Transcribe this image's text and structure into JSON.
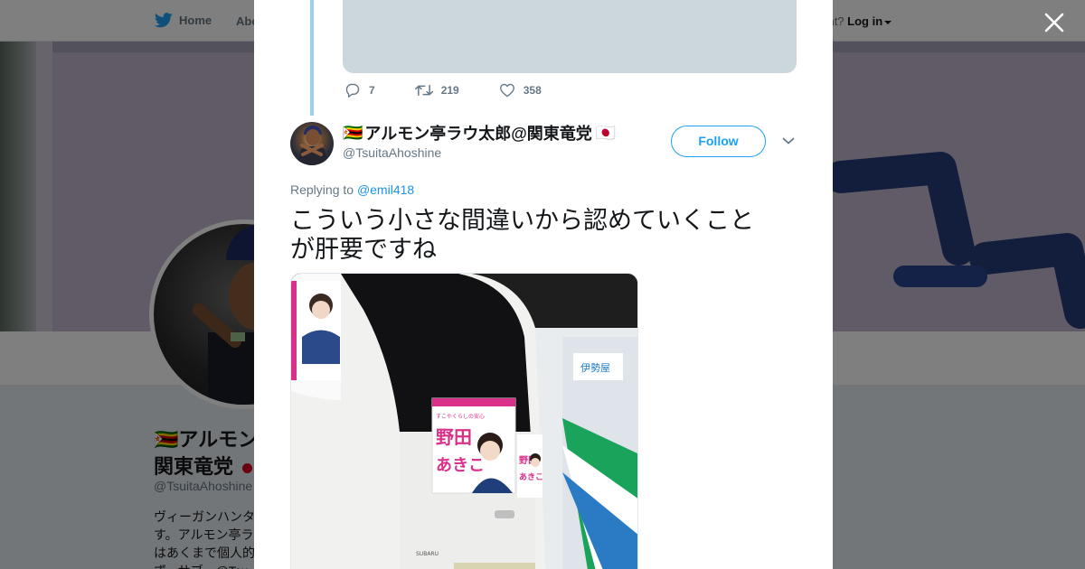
{
  "topnav": {
    "home_label": "Home",
    "about_label": "Abo",
    "account_prompt": "ccount?",
    "login_label": "Log in"
  },
  "profile": {
    "name_line1": "🇿🇼アルモン",
    "name_line2": "関東竜党",
    "handle": "@TsuitaAhoshine",
    "bio_lines": [
      "ヴィーガンハンタ",
      "す。アルモン亭ラ",
      "はあくまで個人的",
      "ず。サブ…@Tsu"
    ]
  },
  "modal": {
    "prev_tweet": {
      "replies": "7",
      "retweets": "219",
      "likes": "358"
    },
    "tweet": {
      "flag_left": "🇿🇼",
      "display_name": "アルモン亭ラウ太郎@関東竜党",
      "flag_right": "🇯🇵",
      "handle": "@TsuitaAhoshine",
      "follow_label": "Follow",
      "replying_prefix": "Replying to",
      "replying_to": "@emil418",
      "text_line1": "こういう小さな間違いから認めていくこと",
      "text_line2": "が肝要ですね",
      "photo": {
        "poster_main_name": "野田",
        "poster_main_name2": "あきこ",
        "poster_side_name": "野田",
        "poster_side_name2": "あきこ",
        "poster_tagline": "すこやくらしの安心",
        "store_sign": "伊勢屋",
        "car_badge": "SUBARU"
      }
    }
  },
  "colors": {
    "twitter_blue": "#1da1f2",
    "link_blue": "#1b95e0",
    "thread_line": "#97d1f6",
    "muted": "#657786",
    "poster_pink": "#d9318a"
  },
  "icons": {
    "nav_home": "twitter-bird-icon",
    "close": "close-icon",
    "reply": "reply-icon",
    "retweet": "retweet-icon",
    "like": "heart-icon",
    "menu": "chevron-down-icon"
  }
}
